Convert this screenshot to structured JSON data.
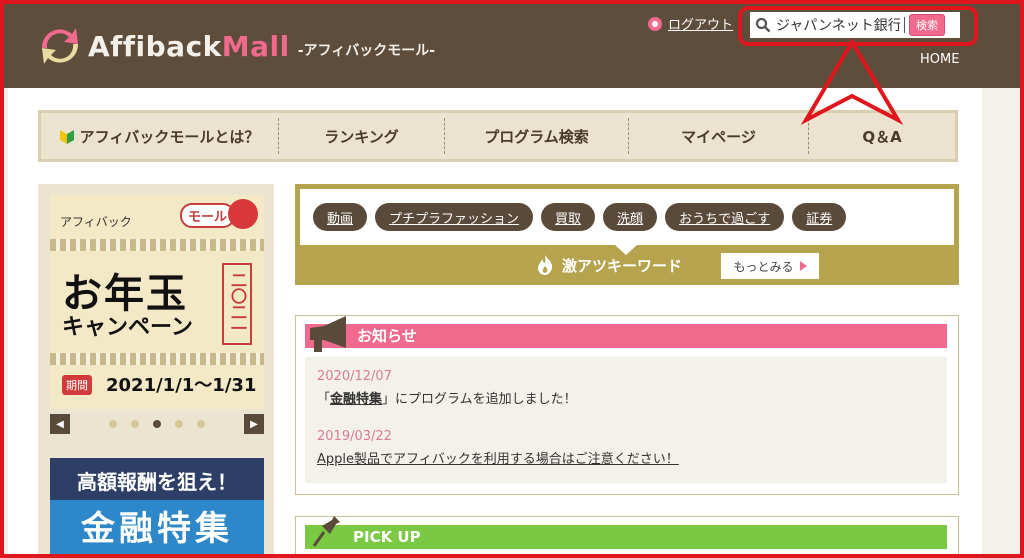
{
  "header": {
    "logo_brand_1": "Affiback",
    "logo_brand_2": "Mall",
    "logo_sub": "-アフィバックモール-",
    "logout_label": "ログアウト",
    "search": {
      "value": "ジャパンネット銀行",
      "button_label": "検索"
    },
    "home_label": "HOME"
  },
  "nav": {
    "items": [
      {
        "label": "アフィバックモールとは？"
      },
      {
        "label": "ランキング"
      },
      {
        "label": "プログラム検索"
      },
      {
        "label": "マイページ"
      },
      {
        "label": "Q＆A"
      }
    ]
  },
  "sidebar": {
    "banner": {
      "small_text": "アフィバック",
      "bubble_text": "モール",
      "title_line1": "お年玉",
      "title_line2": "キャンペーン",
      "stamp_text": "二〇二一",
      "period_label": "期間",
      "period_value": "2021/1/1〜1/31"
    },
    "banner2": {
      "line1": "高額報酬を狙え！",
      "line2": "金融特集"
    }
  },
  "tags": {
    "items": [
      "動画",
      "プチプラファッション",
      "買取",
      "洗顔",
      "おうちで過ごす",
      "証券"
    ],
    "hot_label": "激アツキーワード",
    "more_label": "もっとみる"
  },
  "news": {
    "title": "お知らせ",
    "items": [
      {
        "date": "2020/12/07",
        "prefix": "「",
        "link": "金融特集",
        "suffix": "」にプログラムを追加しました！"
      },
      {
        "date": "2019/03/22",
        "text": "Apple製品でアフィバックを利用する場合はご注意ください！"
      }
    ]
  },
  "pickup": {
    "title": "PICK UP"
  },
  "colors": {
    "header_bg": "#5e4d3b",
    "accent_pink": "#f06a8e",
    "accent_green": "#7ac943",
    "highlight_red": "#e0161e",
    "gold": "#b6a34d"
  }
}
